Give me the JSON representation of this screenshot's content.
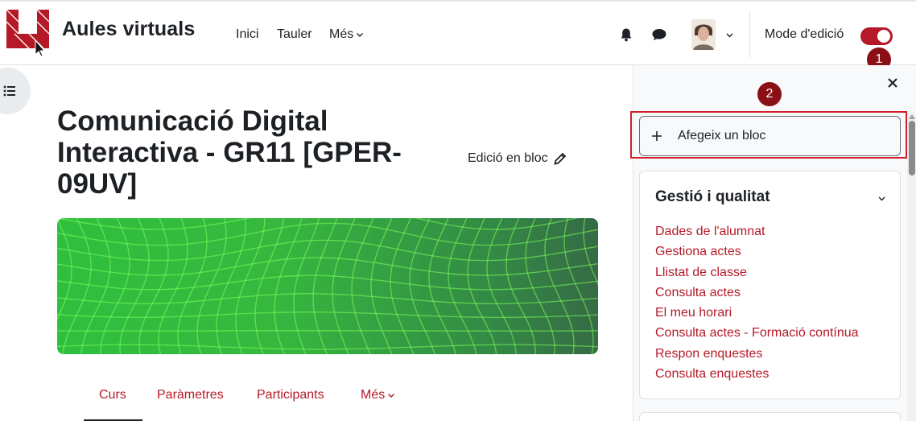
{
  "header": {
    "site_name": "Aules virtuals",
    "nav": [
      {
        "label": "Inici"
      },
      {
        "label": "Tauler"
      },
      {
        "label": "Més"
      }
    ],
    "edit_mode_label": "Mode d'edició",
    "edit_mode_on": true
  },
  "badges": [
    "1",
    "2"
  ],
  "course": {
    "title": "Comunicació Digital Interactiva - GR11 [GPER-09UV]",
    "bulk_edit_label": "Edició en bloc",
    "tabs": [
      {
        "label": "Curs",
        "active": true
      },
      {
        "label": "Paràmetres"
      },
      {
        "label": "Participants"
      },
      {
        "label": "Més"
      }
    ]
  },
  "drawer": {
    "add_block_label": "Afegeix un bloc",
    "block": {
      "title": "Gestió i qualitat",
      "links": [
        "Dades de l'alumnat",
        "Gestiona actes",
        "Llistat de classe",
        "Consulta actes",
        "El meu horari",
        "Consulta actes - Formació contínua",
        "Respon enquestes",
        "Consulta enquestes"
      ]
    }
  },
  "colors": {
    "brand_red": "#b51928",
    "badge_red": "#8a1016",
    "highlight_red": "#d31f2b"
  },
  "icons": [
    "logo-icon",
    "chevron-down-icon",
    "bell-icon",
    "chat-icon",
    "avatar",
    "list-icon",
    "pencil-icon",
    "close-icon",
    "plus-icon"
  ]
}
